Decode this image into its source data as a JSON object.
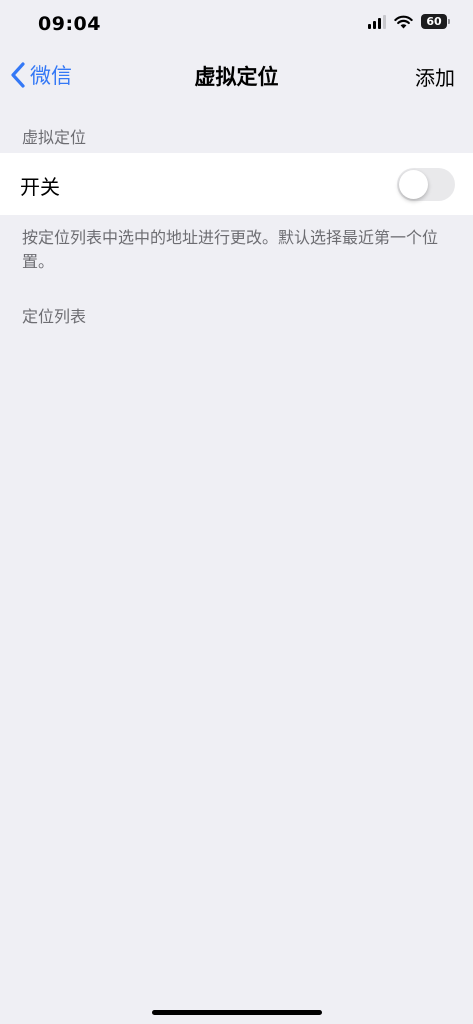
{
  "status_bar": {
    "time": "09:04",
    "battery": "60"
  },
  "nav": {
    "back_label": "微信",
    "title": "虚拟定位",
    "action_label": "添加"
  },
  "sections": {
    "main_header": "虚拟定位",
    "switch_label": "开关",
    "switch_on": false,
    "footer_note": "按定位列表中选中的地址进行更改。默认选择最近第一个位置。",
    "list_header": "定位列表"
  },
  "colors": {
    "accent": "#3478f6",
    "background": "#efeff4",
    "secondary_text": "#6d6d72"
  }
}
